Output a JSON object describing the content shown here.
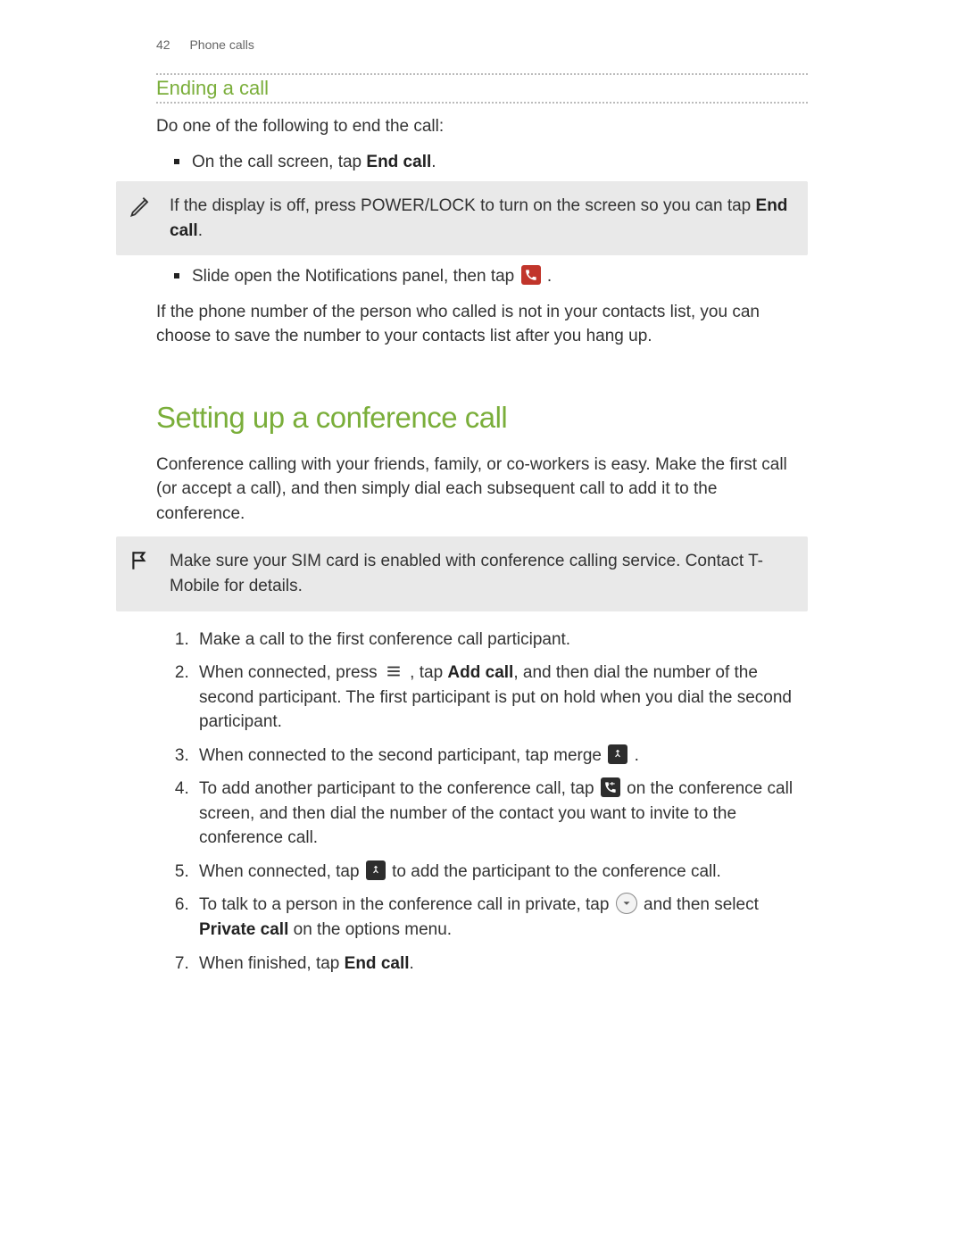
{
  "header": {
    "page_number": "42",
    "section": "Phone calls"
  },
  "section_ending": {
    "title": "Ending a call",
    "intro": "Do one of the following to end the call:",
    "bullet1_pre": "On the call screen, tap ",
    "bullet1_bold": "End call",
    "bullet1_post": ".",
    "tip_text_pre": "If the display is off, press POWER/LOCK to turn on the screen so you can tap ",
    "tip_text_bold": "End call",
    "tip_text_post": ".",
    "bullet2_pre": "Slide open the Notifications panel, then tap ",
    "bullet2_post": ".",
    "after": "If the phone number of the person who called is not in your contacts list, you can choose to save the number to your contacts list after you hang up."
  },
  "section_conference": {
    "title": "Setting up a conference call",
    "intro": "Conference calling with your friends, family, or co-workers is easy. Make the first call (or accept a call), and then simply dial each subsequent call to add it to the conference.",
    "flag_note": "Make sure your SIM card is enabled with conference calling service. Contact T-Mobile for details.",
    "steps": {
      "s1": "Make a call to the first conference call participant.",
      "s2_a": "When connected, press ",
      "s2_b": ", tap ",
      "s2_bold": "Add call",
      "s2_c": ", and then dial the number of the second participant. The first participant is put on hold when you dial the second participant.",
      "s3_a": "When connected to the second participant, tap merge ",
      "s3_b": ".",
      "s4_a": "To add another participant to the conference call, tap ",
      "s4_b": " on the conference call screen, and then dial the number of the contact you want to invite to the conference call.",
      "s5_a": "When connected, tap ",
      "s5_b": " to add the participant to the conference call.",
      "s6_a": "To talk to a person in the conference call in private, tap ",
      "s6_b": " and then select ",
      "s6_bold": "Private call",
      "s6_c": " on the options menu.",
      "s7_a": "When finished, tap ",
      "s7_bold": "End call",
      "s7_b": "."
    }
  }
}
